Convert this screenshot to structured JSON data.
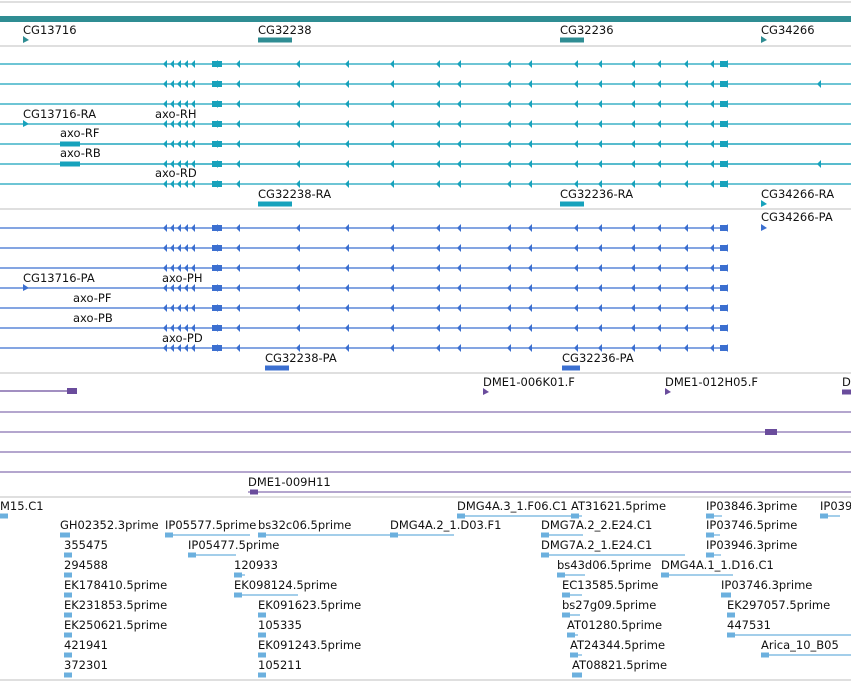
{
  "colors": {
    "gene": "#2f8d93",
    "rna": "#17a2bc",
    "protein": "#3b6fd0",
    "clone": "#6a4c9c",
    "est": "#6cb0de",
    "divider": "#bfbfbf"
  },
  "genes": [
    {
      "label": "CG13716",
      "strand": "+"
    },
    {
      "label": "CG32238",
      "strand": "+"
    },
    {
      "label": "CG32236",
      "strand": "+"
    },
    {
      "label": "CG34266",
      "strand": "+"
    }
  ],
  "transcripts": [
    {
      "label": "CG13716-RA"
    },
    {
      "label": "axo-RH"
    },
    {
      "label": "axo-RF"
    },
    {
      "label": "axo-RB"
    },
    {
      "label": "axo-RD"
    },
    {
      "label": "CG32238-RA"
    },
    {
      "label": "CG32236-RA"
    },
    {
      "label": "CG34266-RA"
    }
  ],
  "proteins": [
    {
      "label": "CG34266-PA"
    },
    {
      "label": "CG13716-PA"
    },
    {
      "label": "axo-PH"
    },
    {
      "label": "axo-PF"
    },
    {
      "label": "axo-PB"
    },
    {
      "label": "axo-PD"
    },
    {
      "label": "CG32238-PA"
    },
    {
      "label": "CG32236-PA"
    }
  ],
  "clones": [
    {
      "label": "DME1-006K01.F"
    },
    {
      "label": "DME1-012H05.F"
    },
    {
      "label": "D"
    },
    {
      "label": "DME1-009H11"
    }
  ],
  "ests": [
    {
      "label": "M15.C1"
    },
    {
      "label": "DMG4A.3_1.F06.C1"
    },
    {
      "label": "AT31621.5prime"
    },
    {
      "label": "IP03846.3prime"
    },
    {
      "label": "IP039"
    },
    {
      "label": "GH02352.3prime"
    },
    {
      "label": "IP05577.5prime"
    },
    {
      "label": "bs32c06.5prime"
    },
    {
      "label": "DMG4A.2_1.D03.F1"
    },
    {
      "label": "DMG7A.2_2.E24.C1"
    },
    {
      "label": "IP03746.5prime"
    },
    {
      "label": "355475"
    },
    {
      "label": "IP05477.5prime"
    },
    {
      "label": "DMG7A.2_1.E24.C1"
    },
    {
      "label": "IP03946.3prime"
    },
    {
      "label": "294588"
    },
    {
      "label": "120933"
    },
    {
      "label": "bs43d06.5prime"
    },
    {
      "label": "DMG4A.1_1.D16.C1"
    },
    {
      "label": "EK178410.5prime"
    },
    {
      "label": "EK098124.5prime"
    },
    {
      "label": "EC13585.5prime"
    },
    {
      "label": "IP03746.3prime"
    },
    {
      "label": "EK231853.5prime"
    },
    {
      "label": "EK091623.5prime"
    },
    {
      "label": "bs27g09.5prime"
    },
    {
      "label": "EK297057.5prime"
    },
    {
      "label": "EK250621.5prime"
    },
    {
      "label": "105335"
    },
    {
      "label": "AT01280.5prime"
    },
    {
      "label": "447531"
    },
    {
      "label": "421941"
    },
    {
      "label": "EK091243.5prime"
    },
    {
      "label": "AT24344.5prime"
    },
    {
      "label": "Arica_10_B05"
    },
    {
      "label": "372301"
    },
    {
      "label": "105211"
    },
    {
      "label": "AT08821.5prime"
    }
  ]
}
